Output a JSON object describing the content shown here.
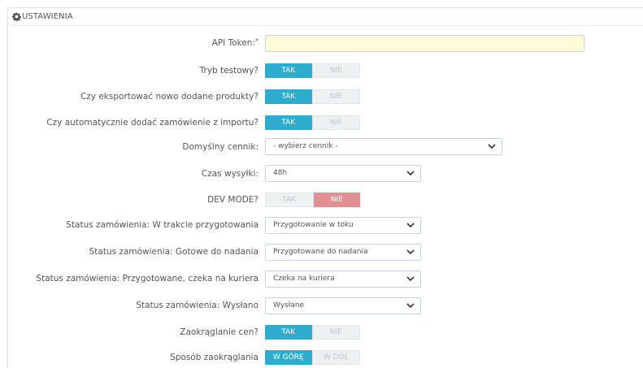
{
  "panel": {
    "title": "USTAWIENIA",
    "icon": "gear-icon"
  },
  "fields": {
    "api_token": {
      "label": "API Token:",
      "required_mark": "*",
      "value": ""
    },
    "tryb_testowy": {
      "label": "Tryb testowy?",
      "yes": "TAK",
      "no": "NIE",
      "selected": "TAK"
    },
    "eksport": {
      "label": "Czy eksportować nowo dodane produkty?",
      "yes": "TAK",
      "no": "NIE",
      "selected": "TAK"
    },
    "auto_import": {
      "label": "Czy automatycznie dodać zamówienie z importu?",
      "yes": "TAK",
      "no": "NIE",
      "selected": "TAK"
    },
    "cennik": {
      "label": "Domyślny cennik:",
      "value": "- wybierz cennik -"
    },
    "czas_wysylki": {
      "label": "Czas wysyłki:",
      "value": "48h"
    },
    "dev_mode": {
      "label": "DEV MODE?",
      "yes": "TAK",
      "no": "NIE",
      "selected": "NIE"
    },
    "status_w_trakcie": {
      "label": "Status zamówienia: W trakcie przygotowania",
      "value": "Przygotowanie w toku"
    },
    "status_gotowe": {
      "label": "Status zamówienia: Gotowe do nadania",
      "value": "Przygotowane do nadania"
    },
    "status_czeka": {
      "label": "Status zamówienia: Przygotowane, czeka na kuriera",
      "value": "Czeka na kuriera"
    },
    "status_wyslano": {
      "label": "Status zamówienia: Wysłano",
      "value": "Wysłane"
    },
    "zaokraglanie": {
      "label": "Zaokrąglanie cen?",
      "yes": "TAK",
      "no": "NIE",
      "selected": "TAK"
    },
    "sposob": {
      "label": "Sposób zaokrąglania",
      "up": "W GÓRĘ",
      "down": "W DÓŁ",
      "selected": "W GÓRĘ"
    }
  },
  "colors": {
    "active": "#2eacce",
    "danger": "#e08f95",
    "input_bg": "#fffbd8"
  }
}
